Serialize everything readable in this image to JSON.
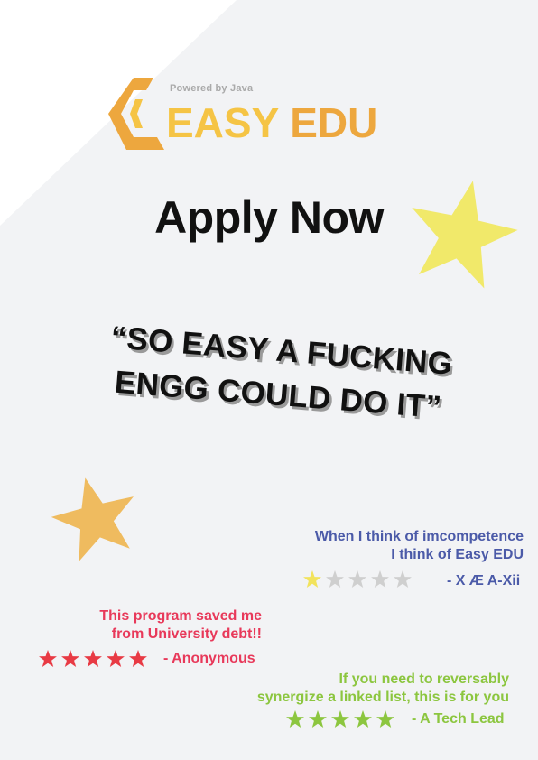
{
  "brand": {
    "powered_by": "Powered by Java",
    "name_part1": "EASY",
    "name_part2": " EDU",
    "colors": {
      "yellow": "#f5c445",
      "orange": "#eda73e"
    }
  },
  "headline": "Apply Now",
  "quote": {
    "line1": "“SO EASY A FUCKING",
    "line2": "ENGG COULD DO IT”"
  },
  "reviews": [
    {
      "line1": "When I think of imcompetence",
      "line2": "I think of Easy EDU",
      "rating": 1,
      "max_rating": 5,
      "author": "- X Æ A-Xii",
      "color": "#4b5aa8",
      "star_color": "#f2e35c"
    },
    {
      "line1": "This program saved me",
      "line2": "from University debt!!",
      "rating": 5,
      "max_rating": 5,
      "author": "- Anonymous",
      "color": "#e8395a",
      "star_color": "#e83a44"
    },
    {
      "line1": "If you need to reversably",
      "line2": "synergize a linked list, this is for you",
      "rating": 5,
      "max_rating": 5,
      "author": "- A Tech Lead",
      "color": "#8cc63f",
      "star_color": "#8cc63f"
    }
  ],
  "decor": {
    "star_yellow": "#f1e96a",
    "star_orange": "#efbb5f",
    "star_empty": "#cfcfcf"
  }
}
